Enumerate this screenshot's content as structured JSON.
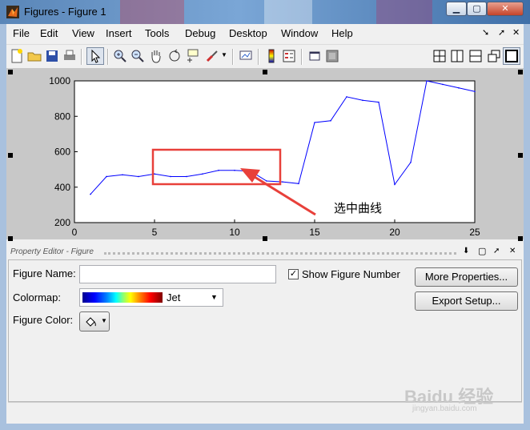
{
  "window": {
    "title": "Figures - Figure 1",
    "caption_buttons": [
      "minimize",
      "maximize",
      "close"
    ]
  },
  "menu": [
    "File",
    "Edit",
    "View",
    "Insert",
    "Tools",
    "Debug",
    "Desktop",
    "Window",
    "Help"
  ],
  "menu_right_icons": [
    "undock-arrow-icon",
    "dock-arrow-icon",
    "close-icon"
  ],
  "toolbar": {
    "left": [
      "new-figure-icon",
      "open-folder-icon",
      "save-icon",
      "print-icon",
      "select-arrow-icon",
      "zoom-in-icon",
      "zoom-out-icon",
      "pan-hand-icon",
      "rotate-3d-icon",
      "data-cursor-icon",
      "brush-icon",
      "brush-dropdown-icon",
      "link-plot-icon",
      "colorbar-icon",
      "legend-icon",
      "hide-plot-tools-icon",
      "show-plot-tools-icon"
    ],
    "right": [
      "tile-icon",
      "left-right-split-icon",
      "top-bottom-split-icon",
      "float-icon",
      "maximize-icon"
    ]
  },
  "chart_data": {
    "type": "line",
    "x": [
      1,
      2,
      3,
      4,
      5,
      6,
      7,
      8,
      9,
      10,
      11,
      12,
      13,
      14,
      15,
      16,
      17,
      18,
      19,
      20,
      21,
      22,
      23,
      24,
      25
    ],
    "series": [
      {
        "values": [
          360,
          460,
          470,
          460,
          475,
          460,
          460,
          475,
          495,
          495,
          490,
          435,
          430,
          420,
          765,
          775,
          910,
          890,
          880,
          415,
          540,
          1000,
          980,
          960,
          940
        ]
      }
    ],
    "xlim": [
      0,
      25
    ],
    "ylim": [
      200,
      1000
    ],
    "xticks": [
      0,
      5,
      10,
      15,
      20,
      25
    ],
    "yticks": [
      200,
      400,
      600,
      800,
      1000
    ],
    "line_color": "#0000ff",
    "grid": false
  },
  "annotation": {
    "label": "选中曲线",
    "color": "#e8403a"
  },
  "property_editor": {
    "title": "Property Editor - Figure",
    "figure_name_label": "Figure Name:",
    "figure_name_value": "",
    "show_figure_number_label": "Show Figure Number",
    "show_figure_number_checked": "✓",
    "more_properties_button": "More Properties...",
    "export_setup_button": "Export Setup...",
    "colormap_label": "Colormap:",
    "colormap_value": "Jet",
    "figure_color_label": "Figure Color:"
  },
  "watermark": {
    "text": "Baidu 经验",
    "url": "jingyan.baidu.com"
  }
}
